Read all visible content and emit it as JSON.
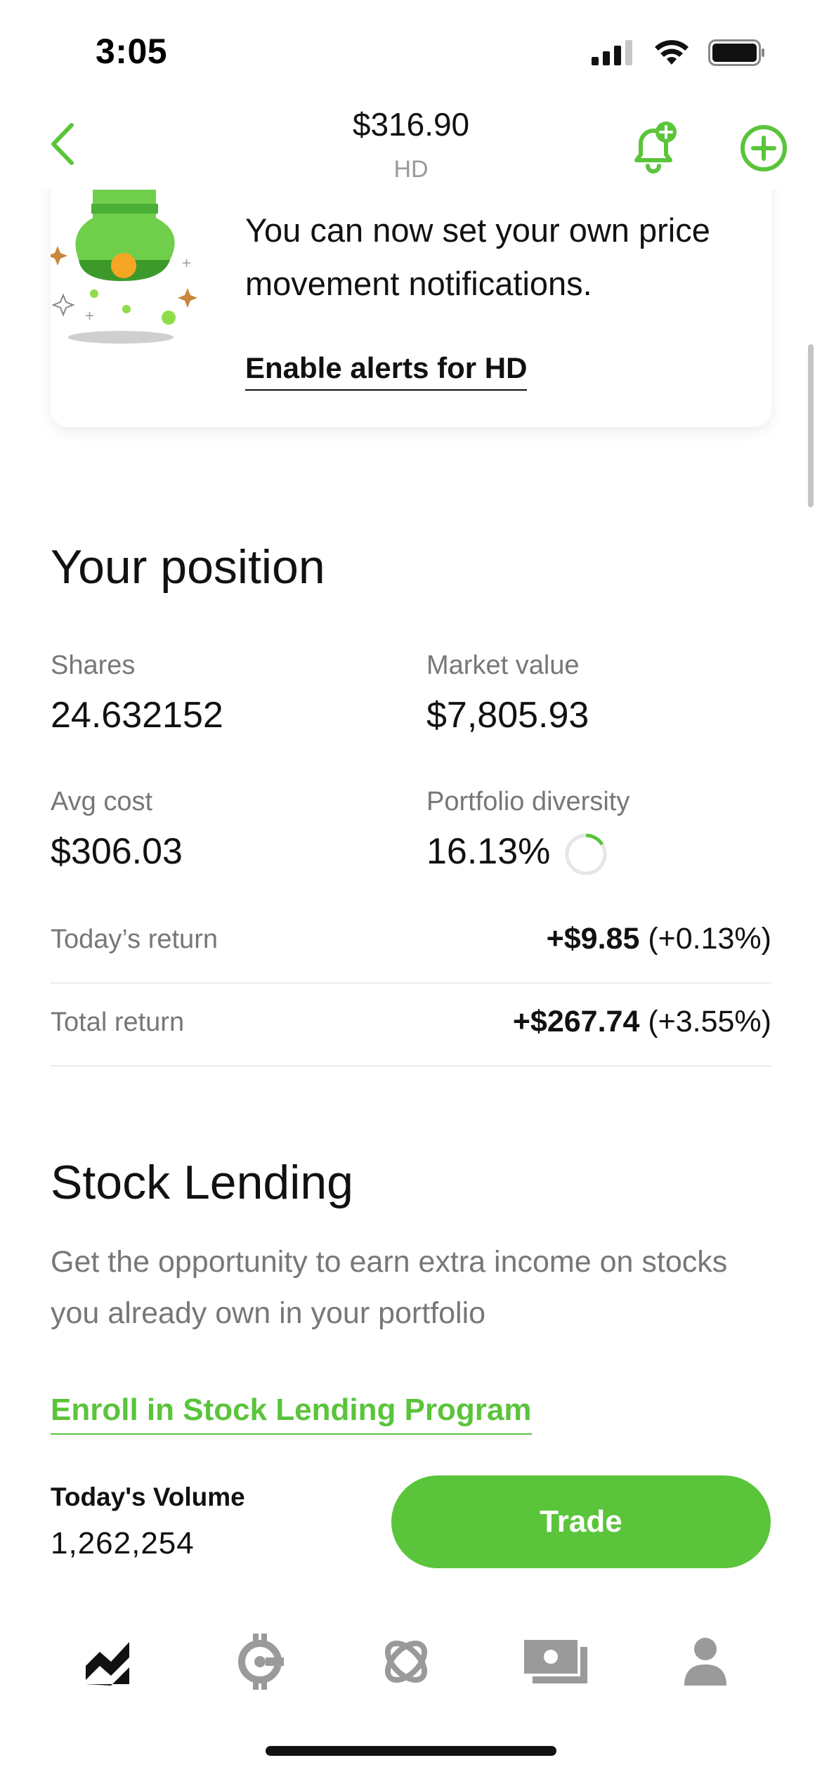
{
  "status_bar": {
    "time": "3:05"
  },
  "header": {
    "price": "$316.90",
    "ticker": "HD"
  },
  "alert_card": {
    "text": "You can now set your own price movement notifications.",
    "link": "Enable alerts for HD"
  },
  "position": {
    "title": "Your position",
    "shares_label": "Shares",
    "shares_value": "24.632152",
    "market_value_label": "Market value",
    "market_value": "$7,805.93",
    "avg_cost_label": "Avg cost",
    "avg_cost_value": "$306.03",
    "diversity_label": "Portfolio diversity",
    "diversity_value": "16.13%",
    "diversity_fraction": 0.1613,
    "todays_return_label": "Today’s return",
    "todays_return_amount": "+$9.85",
    "todays_return_pct": "(+0.13%)",
    "total_return_label": "Total return",
    "total_return_amount": "+$267.74",
    "total_return_pct": "(+3.55%)"
  },
  "lending": {
    "title": "Stock Lending",
    "description": "Get the opportunity to earn extra income on stocks you already own in your portfolio",
    "link": "Enroll in Stock Lending Program"
  },
  "volume": {
    "label": "Today's Volume",
    "value": "1,262,254"
  },
  "trade_button": "Trade",
  "tabs": [
    {
      "icon": "chart-icon",
      "active": true
    },
    {
      "icon": "bitcoin-icon",
      "active": false
    },
    {
      "icon": "discover-icon",
      "active": false
    },
    {
      "icon": "money-icon",
      "active": false
    },
    {
      "icon": "profile-icon",
      "active": false
    }
  ],
  "colors": {
    "accent": "#5ac43b",
    "muted": "#777777",
    "inactive_icon": "#9a9a9a"
  }
}
